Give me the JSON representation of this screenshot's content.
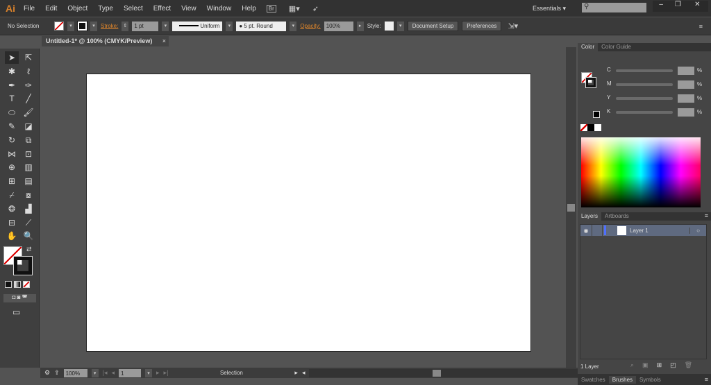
{
  "app": {
    "logo": "Ai",
    "menu": [
      "File",
      "Edit",
      "Object",
      "Type",
      "Select",
      "Effect",
      "View",
      "Window",
      "Help"
    ],
    "bridge": "Br",
    "workspace": "Essentials",
    "search_placeholder": ""
  },
  "control": {
    "selection": "No Selection",
    "stroke_label": "Stroke:",
    "stroke_value": "1 pt",
    "profile": "Uniform",
    "brush": "5 pt. Round",
    "opacity_label": "Opacity:",
    "opacity_value": "100%",
    "style_label": "Style:",
    "doc_setup": "Document Setup",
    "preferences": "Preferences"
  },
  "document": {
    "tab": "Untitled-1* @ 100% (CMYK/Preview)"
  },
  "tools": [
    "selection",
    "direct-selection",
    "magic-wand",
    "lasso",
    "pen",
    "curvature",
    "type",
    "line",
    "ellipse",
    "paintbrush",
    "pencil",
    "eraser",
    "rotate",
    "scale",
    "width",
    "free-transform",
    "shape-builder",
    "perspective-grid",
    "mesh",
    "gradient",
    "eyedropper",
    "blend",
    "symbol-sprayer",
    "column-graph",
    "artboard",
    "slice",
    "hand",
    "zoom"
  ],
  "status": {
    "zoom": "100%",
    "artboard": "1",
    "tool": "Selection"
  },
  "color_panel": {
    "tabs": [
      "Color",
      "Color Guide"
    ],
    "channels": [
      "C",
      "M",
      "Y",
      "K"
    ],
    "unit": "%"
  },
  "layers_panel": {
    "tabs": [
      "Layers",
      "Artboards"
    ],
    "layers": [
      {
        "name": "Layer 1",
        "color": "#4f6fff"
      }
    ],
    "count": "1 Layer"
  },
  "bottom_tabs": [
    "Swatches",
    "Brushes",
    "Symbols"
  ]
}
